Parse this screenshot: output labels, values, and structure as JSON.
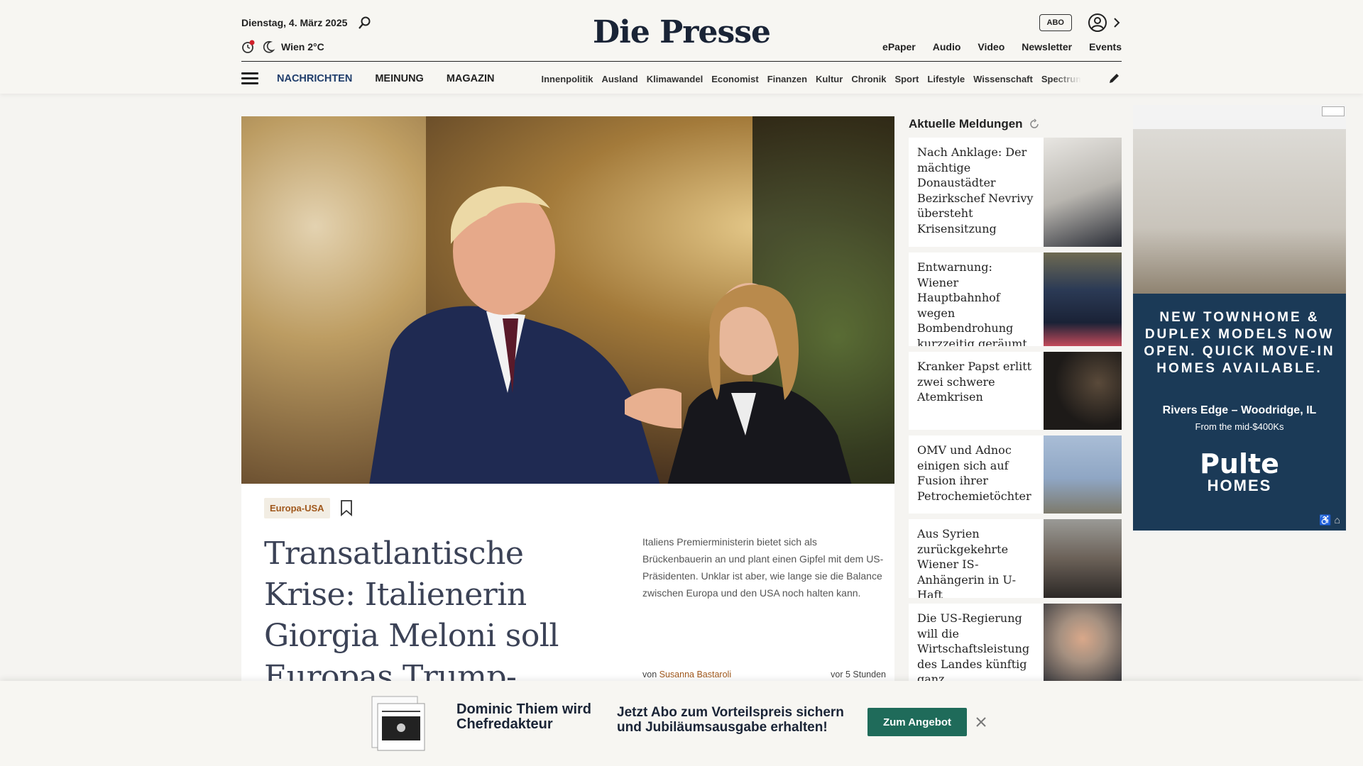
{
  "header": {
    "date": "Dienstag, 4. März 2025",
    "weather": "Wien 2°C",
    "logo": "Die Presse",
    "abo_label": "ABO",
    "toplinks": [
      "ePaper",
      "Audio",
      "Video",
      "Newsletter",
      "Events"
    ],
    "mainnav": [
      "NACHRICHTEN",
      "MEINUNG",
      "MAGAZIN"
    ],
    "subnav": [
      "Innenpolitik",
      "Ausland",
      "Klimawandel",
      "Economist",
      "Finanzen",
      "Kultur",
      "Chronik",
      "Sport",
      "Lifestyle",
      "Wissenschaft",
      "Spectrum"
    ]
  },
  "article": {
    "tag": "Europa-USA",
    "headline": "Transatlantische Krise: Italienerin Giorgia Meloni soll Europas Trump-Flüsterin sein",
    "teaser": "Italiens Premierministerin bietet sich als Brückenbauerin an und plant einen Gipfel mit dem US-Präsidenten. Unklar ist aber, wie lange sie die Balance zwischen Europa und den USA noch halten kann.",
    "byline_prefix": "von",
    "author": "Susanna Bastaroli",
    "time": "vor 5 Stunden"
  },
  "sidebar": {
    "title": "Aktuelle Meldungen",
    "items": [
      {
        "text": "Nach Anklage: Der mächtige Donaustädter Bezirkschef Nevrivy übersteht Krisensitzung",
        "thumb_color": "#b9b6b0"
      },
      {
        "text": "Entwarnung: Wiener Hauptbahnhof wegen Bombendrohung kurzzeitig geräumt",
        "thumb_color": "#2b3a55"
      },
      {
        "text": "Kranker Papst erlitt zwei schwere Atemkrisen",
        "thumb_color": "#1d1a18"
      },
      {
        "text": "OMV und Adnoc einigen sich auf Fusion ihrer Petrochemietöchter",
        "thumb_color": "#8fa6c4"
      },
      {
        "text": "Aus Syrien zurückgekehrte Wiener IS-Anhängerin in U-Haft",
        "thumb_color": "#6b6158"
      },
      {
        "text": "Die US-Regierung will die Wirtschaftsleistung des Landes künftig ganz",
        "thumb_color": "#a59080"
      }
    ]
  },
  "ad": {
    "headline": "NEW TOWNHOME & DUPLEX MODELS NOW OPEN. QUICK MOVE-IN HOMES AVAILABLE.",
    "location": "Rivers Edge – Woodridge, IL",
    "price": "From the mid-$400Ks",
    "brand_name": "Pulte",
    "brand_sub": "HOMES"
  },
  "promo": {
    "title": "Dominic Thiem wird Chefredakteur",
    "text": "Jetzt Abo zum Vorteilspreis sichern und Jubiläumsausgabe erhalten!",
    "button": "Zum Angebot"
  }
}
